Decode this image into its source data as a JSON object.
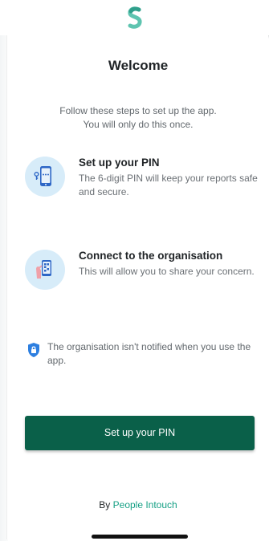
{
  "header": {
    "logo": "s-logo-icon"
  },
  "welcome": {
    "title": "Welcome",
    "intro_line1": "Follow these steps to set up the app.",
    "intro_line2": "You will only do this once."
  },
  "steps": [
    {
      "title": "Set up your PIN",
      "description": "The 6-digit PIN will keep your reports safe and secure.",
      "icon": "phone-pin-icon"
    },
    {
      "title": "Connect to the organisation",
      "description": "This will allow you to share your concern.",
      "icon": "phone-qr-icon"
    }
  ],
  "notice": {
    "icon": "shield-lock-icon",
    "text": "The organisation isn't notified when you use the app."
  },
  "primary_button": {
    "label": "Set up your PIN"
  },
  "footer": {
    "by_label": "By",
    "company": "People Intouch"
  },
  "colors": {
    "brand_green": "#0a6049",
    "accent_teal": "#16a085",
    "icon_bg": "#d7ecf9"
  }
}
